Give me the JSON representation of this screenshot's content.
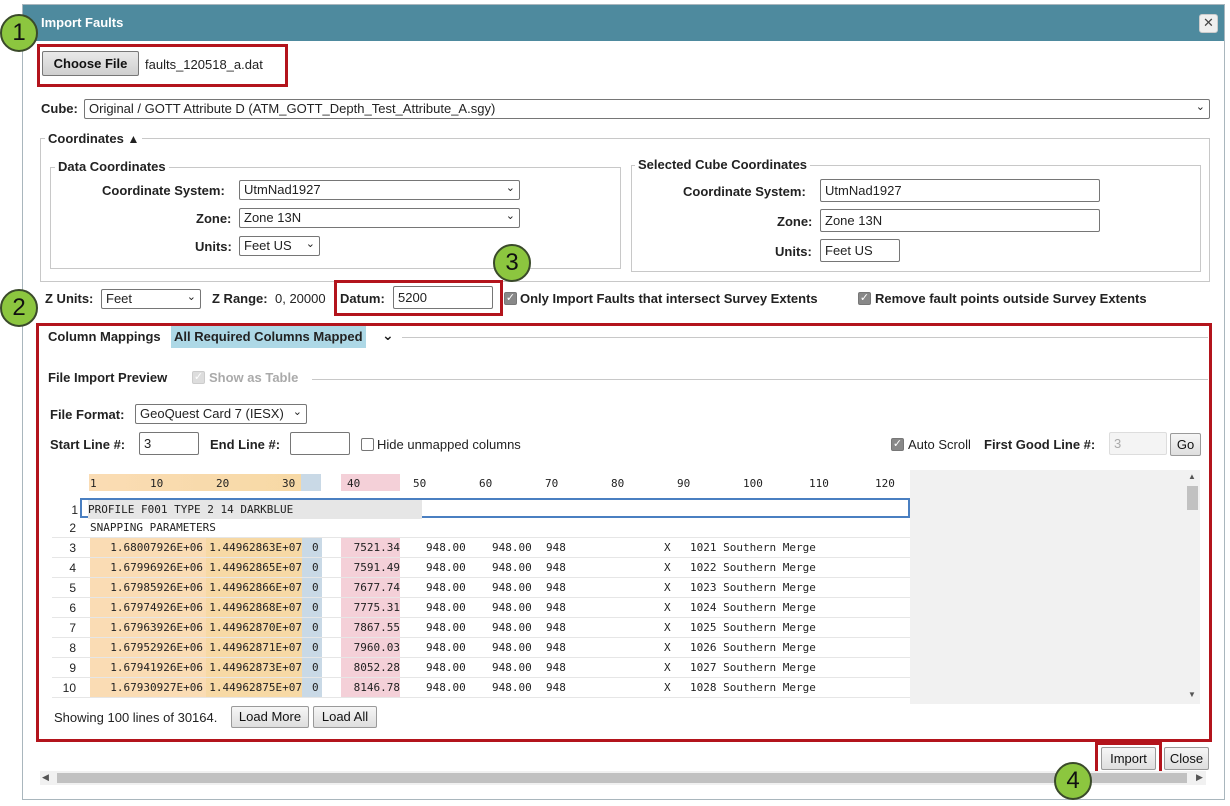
{
  "dialog": {
    "title": "Import Faults",
    "close_glyph": "✕"
  },
  "callouts": [
    "1",
    "2",
    "3",
    "4"
  ],
  "file": {
    "choose_label": "Choose File",
    "file_name": "faults_120518_a.dat"
  },
  "cube": {
    "label": "Cube:",
    "value": "Original / GOTT Attribute D (ATM_GOTT_Depth_Test_Attribute_A.sgy)"
  },
  "coordinates": {
    "legend": "Coordinates",
    "data": {
      "legend": "Data Coordinates",
      "cs_label": "Coordinate System:",
      "cs_value": "UtmNad1927",
      "zone_label": "Zone:",
      "zone_value": "Zone 13N",
      "units_label": "Units:",
      "units_value": "Feet US"
    },
    "cube": {
      "legend": "Selected Cube Coordinates",
      "cs_label": "Coordinate System:",
      "cs_value": "UtmNad1927",
      "zone_label": "Zone:",
      "zone_value": "Zone 13N",
      "units_label": "Units:",
      "units_value": "Feet US"
    }
  },
  "options": {
    "zunits_label": "Z Units:",
    "zunits_value": "Feet",
    "zrange_label": "Z Range:",
    "zrange_value": "0, 20000",
    "datum_label": "Datum:",
    "datum_value": "5200",
    "only_import_label": "Only Import Faults that intersect Survey Extents",
    "remove_points_label": "Remove fault points outside Survey Extents"
  },
  "mappings": {
    "label": "Column Mappings",
    "status": "All Required Columns Mapped",
    "preview_label": "File Import Preview",
    "show_table_label": "Show as Table",
    "format_label": "File Format:",
    "format_value": "GeoQuest Card 7 (IESX)",
    "start_label": "Start Line #:",
    "start_value": "3",
    "end_label": "End Line #:",
    "end_value": "",
    "hide_unmapped_label": "Hide unmapped columns",
    "auto_scroll_label": "Auto Scroll",
    "first_good_label": "First Good Line #:",
    "first_good_value": "3",
    "go_label": "Go"
  },
  "ruler": [
    "1",
    "10",
    "20",
    "30",
    "40",
    "50",
    "60",
    "70",
    "80",
    "90",
    "100",
    "110",
    "120"
  ],
  "preview_lines": [
    {
      "n": "1",
      "text": "PROFILE F001            TYPE 2 14 DARKBLUE"
    },
    {
      "n": "2",
      "text": "SNAPPING PARAMETERS"
    }
  ],
  "rows": [
    {
      "n": "3",
      "x": "1.68007926E+06",
      "y": "1.44962863E+07",
      "f": "0",
      "z": "7521.34",
      "a": "948.00",
      "b": "948.00",
      "c": "948",
      "d": "X",
      "id": "1021 Southern Merge"
    },
    {
      "n": "4",
      "x": "1.67996926E+06",
      "y": "1.44962865E+07",
      "f": "0",
      "z": "7591.49",
      "a": "948.00",
      "b": "948.00",
      "c": "948",
      "d": "X",
      "id": "1022 Southern Merge"
    },
    {
      "n": "5",
      "x": "1.67985926E+06",
      "y": "1.44962866E+07",
      "f": "0",
      "z": "7677.74",
      "a": "948.00",
      "b": "948.00",
      "c": "948",
      "d": "X",
      "id": "1023 Southern Merge"
    },
    {
      "n": "6",
      "x": "1.67974926E+06",
      "y": "1.44962868E+07",
      "f": "0",
      "z": "7775.31",
      "a": "948.00",
      "b": "948.00",
      "c": "948",
      "d": "X",
      "id": "1024 Southern Merge"
    },
    {
      "n": "7",
      "x": "1.67963926E+06",
      "y": "1.44962870E+07",
      "f": "0",
      "z": "7867.55",
      "a": "948.00",
      "b": "948.00",
      "c": "948",
      "d": "X",
      "id": "1025 Southern Merge"
    },
    {
      "n": "8",
      "x": "1.67952926E+06",
      "y": "1.44962871E+07",
      "f": "0",
      "z": "7960.03",
      "a": "948.00",
      "b": "948.00",
      "c": "948",
      "d": "X",
      "id": "1026 Southern Merge"
    },
    {
      "n": "9",
      "x": "1.67941926E+06",
      "y": "1.44962873E+07",
      "f": "0",
      "z": "8052.28",
      "a": "948.00",
      "b": "948.00",
      "c": "948",
      "d": "X",
      "id": "1027 Southern Merge"
    },
    {
      "n": "10",
      "x": "1.67930927E+06",
      "y": "1.44962875E+07",
      "f": "0",
      "z": "8146.78",
      "a": "948.00",
      "b": "948.00",
      "c": "948",
      "d": "X",
      "id": "1028 Southern Merge"
    }
  ],
  "footer": {
    "showing": "Showing 100 lines of 30164.",
    "load_more": "Load More",
    "load_all": "Load All",
    "import": "Import",
    "close": "Close"
  },
  "colors": {
    "title_bar": "#4e8a9e",
    "callout": "#8cc63f",
    "highlight": "#b3141c",
    "status_bg": "#add8e6",
    "col_xy": "#f9d8a8",
    "col_flag": "#c9d9e6",
    "col_z": "#f4d0d8"
  }
}
